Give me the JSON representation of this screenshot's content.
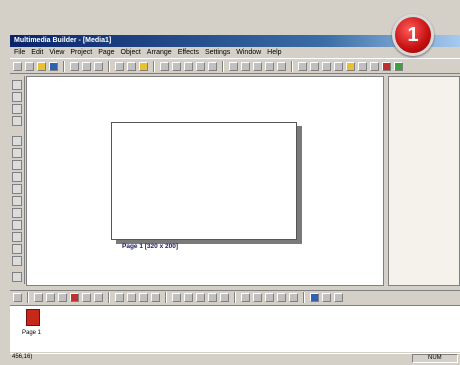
{
  "window": {
    "title": "Multimedia Builder - [Media1]"
  },
  "menu": [
    "File",
    "Edit",
    "View",
    "Project",
    "Page",
    "Object",
    "Arrange",
    "Effects",
    "Settings",
    "Window",
    "Help"
  ],
  "canvas": {
    "page_label": "Page 1 [320 x 200]"
  },
  "page_strip": {
    "thumb_label": "Page 1"
  },
  "status": {
    "coords": "456,16)",
    "num": "NUM"
  },
  "badge": {
    "text": "1"
  },
  "colors": {
    "title_bar": "#0a246a",
    "badge": "#c41010",
    "page_thumb": "#c82818"
  }
}
